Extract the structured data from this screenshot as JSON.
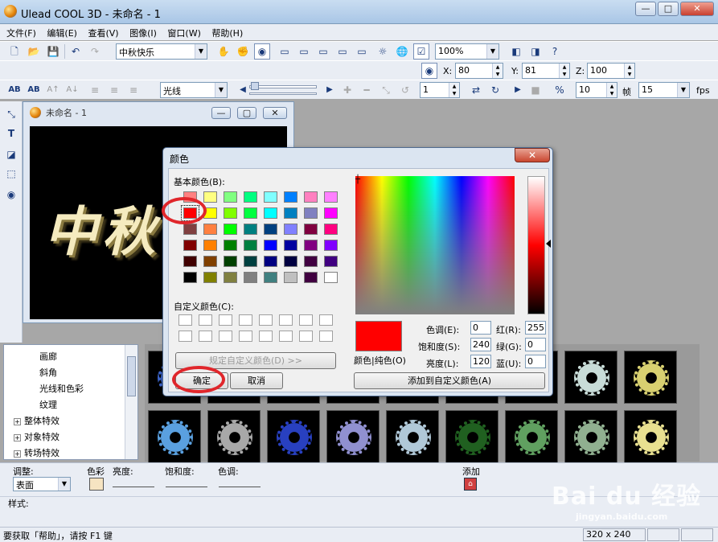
{
  "window": {
    "title": "Ulead COOL 3D - 未命名 - 1",
    "min": "—",
    "max": "□",
    "close": "✕"
  },
  "menu": [
    "文件(F)",
    "编辑(E)",
    "查看(V)",
    "图像(I)",
    "窗口(W)",
    "帮助(H)"
  ],
  "toolbar1": {
    "text_select": "中秋快乐",
    "zoom_select": "100%"
  },
  "coords": {
    "x_label": "X:",
    "x_value": "80",
    "y_label": "Y:",
    "y_value": "81",
    "z_label": "Z:",
    "z_value": "100"
  },
  "toolbar2": {
    "effect_select": "光线",
    "frame_value": "1",
    "frames_total": "10",
    "frame_label": "帧",
    "fps_value": "15",
    "fps_label": "fps"
  },
  "canvas_window": {
    "title": "未命名 - 1",
    "text": "中秋"
  },
  "color_dialog": {
    "title": "颜色",
    "basic_colors_label": "基本颜色(B):",
    "custom_colors_label": "自定义颜色(C):",
    "define_custom_button": "规定自定义颜色(D) >>",
    "ok_button": "确定",
    "cancel_button": "取消",
    "solid_label": "颜色|纯色(O)",
    "add_custom_button": "添加到自定义颜色(A)",
    "hue_label": "色调(E):",
    "hue": "0",
    "sat_label": "饱和度(S):",
    "sat": "240",
    "lum_label": "亮度(L):",
    "lum": "120",
    "red_label": "红(R):",
    "red": "255",
    "green_label": "绿(G):",
    "green": "0",
    "blue_label": "蓝(U):",
    "blue": "0",
    "current_color": "#ff0000",
    "basic_colors": [
      "#ff8080",
      "#ffff80",
      "#80ff80",
      "#00ff80",
      "#80ffff",
      "#0080ff",
      "#ff80c0",
      "#ff80ff",
      "#ff0000",
      "#ffff00",
      "#80ff00",
      "#00ff40",
      "#00ffff",
      "#0080c0",
      "#8080c0",
      "#ff00ff",
      "#804040",
      "#ff8040",
      "#00ff00",
      "#008080",
      "#004080",
      "#8080ff",
      "#800040",
      "#ff0080",
      "#800000",
      "#ff8000",
      "#008000",
      "#008040",
      "#0000ff",
      "#0000a0",
      "#800080",
      "#8000ff",
      "#400000",
      "#804000",
      "#004000",
      "#004040",
      "#000080",
      "#000040",
      "#400040",
      "#400080",
      "#000000",
      "#808000",
      "#808040",
      "#808080",
      "#408080",
      "#c0c0c0",
      "#400040",
      "#ffffff"
    ]
  },
  "tree": {
    "items": [
      "画廊",
      "斜角",
      "光线和色彩",
      "纹理",
      "整体特效",
      "对象特效",
      "转场特效"
    ]
  },
  "gallery": {
    "gears": [
      "#3c64c8",
      "#c8b478",
      "#6478c8",
      "#8c8cc8",
      "#78b4dc",
      "#40a040",
      "#78c878",
      "#c8dcd8",
      "#d8d070",
      "#5aa0e0",
      "#a8a8a8",
      "#2840c0",
      "#9090d0",
      "#b0c8d8",
      "#206020",
      "#60a060",
      "#90b090",
      "#e8e090"
    ]
  },
  "attr": {
    "adjust_label": "调整:",
    "adjust_value": "表面",
    "color_label": "色彩",
    "brightness_label": "亮度:",
    "saturation_label": "饱和度:",
    "hue_label": "色调:",
    "add_label": "添加",
    "style_label": "样式:"
  },
  "status": {
    "help_text": "要获取「帮助」，请按 F1 键",
    "size": "320 x 240"
  },
  "watermark": {
    "brand": "Bai du 经验",
    "url": "jingyan.baidu.com"
  },
  "colors": {
    "accent_red": "#e0262b"
  }
}
